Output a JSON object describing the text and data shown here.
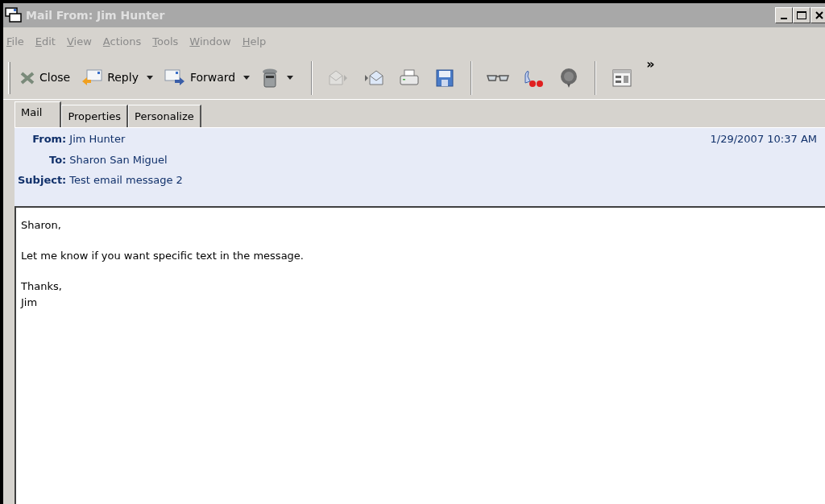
{
  "window": {
    "title": "Mail From: Jim Hunter"
  },
  "menu": [
    "File",
    "Edit",
    "View",
    "Actions",
    "Tools",
    "Window",
    "Help"
  ],
  "toolbar": [
    {
      "kind": "button",
      "label": "Close"
    },
    {
      "kind": "split",
      "label": "Reply"
    },
    {
      "kind": "split",
      "label": "Forward"
    },
    {
      "kind": "split"
    },
    {
      "kind": "separator"
    },
    {
      "kind": "disabled"
    },
    {
      "kind": "icon"
    },
    {
      "kind": "icon"
    },
    {
      "kind": "icon"
    },
    {
      "kind": "separator"
    },
    {
      "kind": "icon"
    },
    {
      "kind": "icon"
    },
    {
      "kind": "icon"
    },
    {
      "kind": "separator"
    },
    {
      "kind": "icon"
    },
    {
      "kind": "more",
      "label": "»"
    }
  ],
  "tabs": [
    {
      "label": "Mail",
      "selected": true
    },
    {
      "label": "Properties",
      "selected": false
    },
    {
      "label": "Personalize",
      "selected": false
    }
  ],
  "header": {
    "fields": [
      {
        "label": "From:",
        "value": "Jim Hunter"
      },
      {
        "label": "To:",
        "value": "Sharon San Miguel"
      },
      {
        "label": "Subject:",
        "value": "Test email message 2"
      }
    ],
    "date": "1/29/2007 10:37 AM"
  },
  "body": [
    {
      "lines": [
        "Sharon,"
      ]
    },
    {
      "lines": [
        "Let me know if you want specific text in the message."
      ]
    },
    {
      "lines": [
        "Thanks,",
        "Jim"
      ]
    }
  ]
}
